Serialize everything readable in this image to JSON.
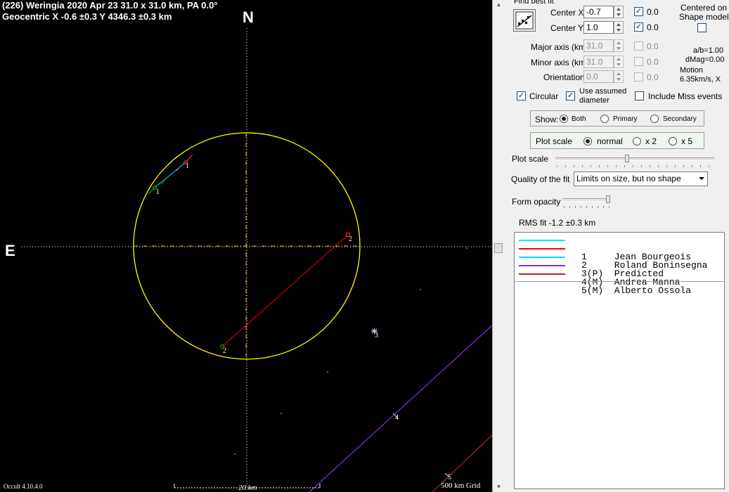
{
  "plot": {
    "title_line1": "(226) Weringia  2020 Apr 23  31.0 x 31.0 km,  PA 0.0°",
    "title_line2": "Geocentric  X  -0.6 ±0.3  Y 4346.3 ±0.3 km",
    "north_label": "N",
    "east_label": "E",
    "version": "Occult 4.10.4.0",
    "scale_label": "20 km",
    "grid_label": "500 km Grid",
    "chord_labels": [
      "1",
      "1",
      "2",
      "2",
      "3",
      "4",
      "5"
    ],
    "colors": {
      "background": "#000000",
      "outline": "#ffff00",
      "axes": "#ffffff",
      "centre_lines": "#ffa500",
      "chord1": "#00e5ff",
      "chord2": "#ff0000",
      "chord4": "#8a2be2",
      "chord5": "#a52a2a",
      "start_marker": "#00c000",
      "end_marker": "#ff3030"
    }
  },
  "panel": {
    "find_best_fit": {
      "label": "Find best fit",
      "icon": "fit-icon"
    },
    "center_x": {
      "label": "Center X",
      "value": "-0.7",
      "checked": true,
      "result": "0.0"
    },
    "center_y": {
      "label": "Center Y",
      "value": "1.0",
      "checked": true,
      "result": "0.0"
    },
    "centered_on_shape": {
      "label_line1": "Centered on",
      "label_line2": "Shape model",
      "checked": false
    },
    "major_axis": {
      "label": "Major axis (km)",
      "value": "31.0",
      "checked": false,
      "result": "0.0"
    },
    "minor_axis": {
      "label": "Minor axis (km)",
      "value": "31.0",
      "checked": false,
      "result": "0.0"
    },
    "orientation": {
      "label": "Orientation",
      "value": "0.0",
      "checked": false,
      "result": "0.0"
    },
    "ab_ratio": "a/b=1.00",
    "dmag": "dMag=0.00",
    "motion_line1": "Motion",
    "motion_line2": "6.35km/s, X",
    "circular": {
      "label": "Circular",
      "checked": true
    },
    "use_assumed": {
      "label_line1": "Use assumed",
      "label_line2": "diameter",
      "checked": true
    },
    "include_miss": {
      "label": "Include Miss events",
      "checked": false
    },
    "show": {
      "label": "Show:",
      "options": [
        "Both",
        "Primary",
        "Secondary"
      ],
      "selected": "Both"
    },
    "plot_scale_radio": {
      "label": "Plot scale",
      "options": [
        "normal",
        "x 2",
        "x 5"
      ],
      "selected": "normal"
    },
    "plot_scale_slider": {
      "label": "Plot scale",
      "level": 0.47
    },
    "quality": {
      "label": "Quality of the fit",
      "value": "Limits on size, but no shape"
    },
    "form_opacity": {
      "label": "Form opacity",
      "level": 0.98
    },
    "rms_fit": "RMS fit -1.2 ±0.3 km",
    "legend": [
      {
        "text": "1     Jean Bourgeois",
        "color": "#00e5ff"
      },
      {
        "text": "2     Roland Boninsegna",
        "color": "#ff0000"
      },
      {
        "text": "3(P)  Predicted",
        "color": "#00e5ff"
      },
      {
        "text": "4(M)  Andrea Manna",
        "color": "#8a2be2"
      },
      {
        "text": "5(M)  Alberto Ossola",
        "color": "#a52a2a"
      }
    ]
  }
}
